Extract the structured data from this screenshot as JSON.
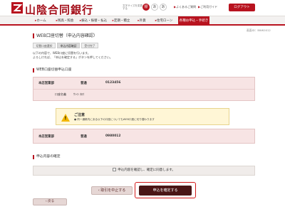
{
  "header": {
    "logo_text": "山陰合同銀行",
    "fontsize_label": "文字サイズを変更する",
    "fontsize_options": [
      "標",
      "あ",
      "あ"
    ],
    "help_link": "よくあるご質問",
    "guide_link": "ご利用ガイド",
    "logout": "ログアウト"
  },
  "nav": {
    "items": [
      "ホーム",
      "残高・照会",
      "振込・振替・払込",
      "定期・積立",
      "外貨",
      "住宅ローン",
      "各種お申込・手続き"
    ],
    "active_index": 6
  },
  "screen_id": "画面ID：BWK0012",
  "page_title": "WEB口座切替（申込内容確認）",
  "steps": [
    "切替口座選択",
    "申込内容確認",
    "受付完了"
  ],
  "current_step": 1,
  "description": [
    "以下の内容で、WEB口座に切替を行います。",
    "よろしければ、「申込を確定する」ボタンを押してください。"
  ],
  "switch_section": {
    "title": "WEB口座切替申込口座",
    "branch": "本店営業部",
    "type": "普通",
    "number": "0123456",
    "name_label": "口座名義",
    "name_value": "ｻﾝｲﾝ ﾀﾛｳ"
  },
  "caution": {
    "title": "ご注意",
    "text": "同一通帳内にある以下の口座についてもWEB口座に切り替わります"
  },
  "linked_account": {
    "branch": "本店営業部",
    "type": "普通",
    "number": "0980012"
  },
  "confirm_section": {
    "title": "申込内容の確定",
    "checkbox_label": "申込内容を確認し、確定に同意します。"
  },
  "buttons": {
    "cancel": "取引を中止する",
    "submit": "申込を確定する",
    "back": "戻る"
  },
  "colors": {
    "brand": "#b8131f",
    "submit_bg": "#4a1515",
    "account_box": "#f7e4e4",
    "caution_bg": "#fff6d6"
  }
}
